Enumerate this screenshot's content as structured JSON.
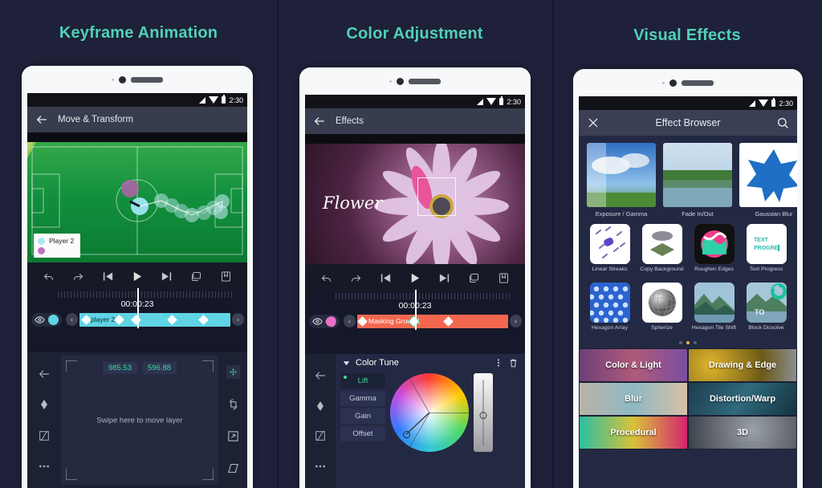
{
  "theme": {
    "bg": "#1e2139",
    "accent": "#4fd1b8",
    "divider": "#151829"
  },
  "panels": [
    {
      "title": "Keyframe Animation",
      "statusbar": {
        "time": "2:30"
      },
      "appbar": {
        "back_icon": "arrow-left-icon",
        "title": "Move & Transform"
      },
      "preview": {
        "legend": [
          {
            "label": "Player 2",
            "color": "#a9e8f0"
          },
          {
            "label": "",
            "color": "#c370be"
          }
        ]
      },
      "transport": [
        "undo-icon",
        "redo-icon",
        "skip-to-start-icon",
        "play-icon",
        "skip-to-end-icon",
        "loop-icon",
        "bookmark-icon"
      ],
      "timeline": {
        "time": "00:00:23",
        "eye_icon": "eye-icon",
        "swatch_color": "#5fd4e4",
        "prev_label": "‹",
        "next_label": "›",
        "clip_label": "player 2",
        "clip_color": "#5fd4e4",
        "keyframes": [
          8,
          26,
          46,
          76,
          100
        ]
      },
      "editor": {
        "rail": [
          "arrow-left-icon",
          "keyframe-diamond-icon",
          "easing-curve-icon",
          "more-horizontal-icon"
        ],
        "x_value": "985.53",
        "y_value": "596.88",
        "hint": "Swipe here to move layer",
        "tools": [
          "move-tool-icon",
          "rotate-tool-icon",
          "scale-tool-icon",
          "skew-tool-icon"
        ],
        "active_tool": "move-tool-icon"
      }
    },
    {
      "title": "Color Adjustment",
      "statusbar": {
        "time": "2:30"
      },
      "appbar": {
        "back_icon": "arrow-left-icon",
        "title": "Effects"
      },
      "preview": {
        "overlay_text": "Flower"
      },
      "transport": [
        "undo-icon",
        "redo-icon",
        "skip-to-start-icon",
        "play-icon",
        "skip-to-end-icon",
        "loop-icon",
        "bookmark-icon"
      ],
      "timeline": {
        "time": "00:00:23",
        "eye_icon": "eye-icon",
        "swatch_color": "#e870c8",
        "prev_label": "‹",
        "next_label": "›",
        "clip_label": "Masking Group 1",
        "clip_color": "#f4674f",
        "keyframes": [
          4,
          38,
          62
        ]
      },
      "color_tune": {
        "collapse_icon": "triangle-down-icon",
        "title": "Color Tune",
        "menu_icon": "more-vertical-icon",
        "delete_icon": "trash-icon",
        "tabs": [
          "Lift",
          "Gamma",
          "Gain",
          "Offset"
        ],
        "active_tab": "Lift",
        "rail": [
          "arrow-left-icon",
          "keyframe-diamond-icon",
          "easing-curve-icon",
          "more-horizontal-icon"
        ]
      }
    },
    {
      "title": "Visual Effects",
      "statusbar": {
        "time": "2:30"
      },
      "appbar": {
        "close_icon": "close-icon",
        "title": "Effect Browser",
        "search_icon": "search-icon"
      },
      "featured": [
        {
          "label": "Exposure / Gamma",
          "thumb": "sky-clouds"
        },
        {
          "label": "Fade In/Out",
          "thumb": "lake-reflection"
        },
        {
          "label": "Gaussian Blur",
          "thumb": "blue-star"
        }
      ],
      "effects": [
        {
          "label": "Linear Streaks",
          "thumb": "streaks"
        },
        {
          "label": "Copy Background",
          "thumb": "copy-bg"
        },
        {
          "label": "Roughen Edges",
          "thumb": "roughen"
        },
        {
          "label": "Text Progress",
          "thumb": "text-progress",
          "overlay": "TEXT PROGRESS"
        },
        {
          "label": "Hexagon Array",
          "thumb": "hex-array"
        },
        {
          "label": "Spherize",
          "thumb": "sphere"
        },
        {
          "label": "Hexagon Tile Shift",
          "thumb": "hex-tile"
        },
        {
          "label": "Block Dissolve",
          "thumb": "block-dissolve",
          "overlay": "TO"
        }
      ],
      "pager": {
        "count": 3,
        "active": 1
      },
      "categories": [
        {
          "label": "Color & Light",
          "color": "#7b4f7e"
        },
        {
          "label": "Drawing & Edge",
          "color": "#8a7420"
        },
        {
          "label": "Blur",
          "color": "#9aa0a6"
        },
        {
          "label": "Distortion/Warp",
          "color": "#2c4b5e"
        },
        {
          "label": "Procedural",
          "color": "#b6356f"
        },
        {
          "label": "3D",
          "color": "#585c66"
        }
      ]
    }
  ]
}
